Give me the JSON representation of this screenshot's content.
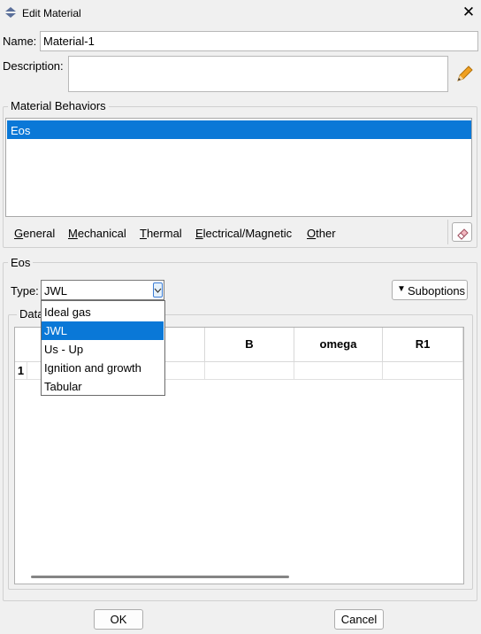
{
  "window": {
    "title": "Edit Material"
  },
  "name": {
    "label": "Name:",
    "value": "Material-1"
  },
  "description": {
    "label": "Description:",
    "value": ""
  },
  "behaviors": {
    "title": "Material Behaviors",
    "items": [
      "Eos"
    ],
    "selected": "Eos"
  },
  "menu": [
    {
      "label": "General",
      "underline": "G",
      "rest": "eneral"
    },
    {
      "label": "Mechanical",
      "underline": "M",
      "rest": "echanical"
    },
    {
      "label": "Thermal",
      "underline": "T",
      "rest": "hermal"
    },
    {
      "label": "Electrical/Magnetic",
      "underline": "E",
      "rest": "lectrical/Magnetic"
    },
    {
      "label": "Other",
      "underline": "O",
      "rest": "ther"
    }
  ],
  "eos": {
    "title": "Eos",
    "type_label": "Type:",
    "type_value": "JWL",
    "suboptions_label": "Suboptions",
    "data_label": "Data",
    "dropdown_options": [
      "Ideal gas",
      "JWL",
      "Us - Up",
      "Ignition and growth",
      "Tabular"
    ],
    "dropdown_selected": "JWL",
    "table": {
      "headers": [
        "",
        "B",
        "omega",
        "R1"
      ],
      "rows": [
        [
          "1",
          "",
          "",
          "",
          ""
        ]
      ]
    }
  },
  "buttons": {
    "ok": "OK",
    "cancel": "Cancel"
  },
  "colors": {
    "selection": "#0a78d7",
    "background": "#f0f0f0"
  }
}
